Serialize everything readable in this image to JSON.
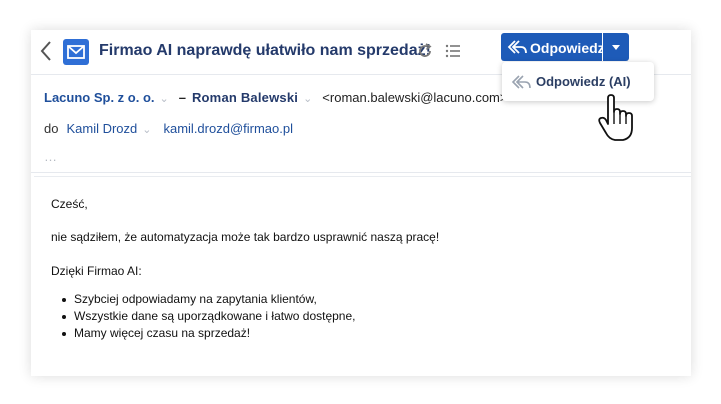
{
  "header": {
    "subject": "Firmao AI naprawdę ułatwiło nam sprzedaż!",
    "reply_label": "Odpowiedz",
    "accent": "#1e5bb8",
    "icons": [
      "chevron-left-icon",
      "mail-icon",
      "refresh-icon",
      "list-icon",
      "reply-icon",
      "caret-down-icon"
    ]
  },
  "dropdown": {
    "items": [
      {
        "label": "Odpowiedz (AI)",
        "icon": "reply-icon"
      }
    ]
  },
  "meta": {
    "from_company": "Lacuno Sp. z o. o.",
    "from_separator": "–",
    "from_name": "Roman  Balewski",
    "from_email": "<roman.balewski@lacuno.com>",
    "to_label": "do",
    "to_name": "Kamil Drozd",
    "to_email": "kamil.drozd@firmao.pl",
    "more": "…"
  },
  "body": {
    "greeting": "Cześć,",
    "line1": "nie sądziłem, że automatyzacja może tak bardzo usprawnić naszą pracę!",
    "line2": "Dzięki Firmao AI:",
    "bullets": [
      "Szybciej odpowiadamy na zapytania klientów,",
      "Wszystkie dane są uporządkowane i łatwo dostępne,",
      "Mamy więcej czasu na sprzedaż!"
    ]
  }
}
